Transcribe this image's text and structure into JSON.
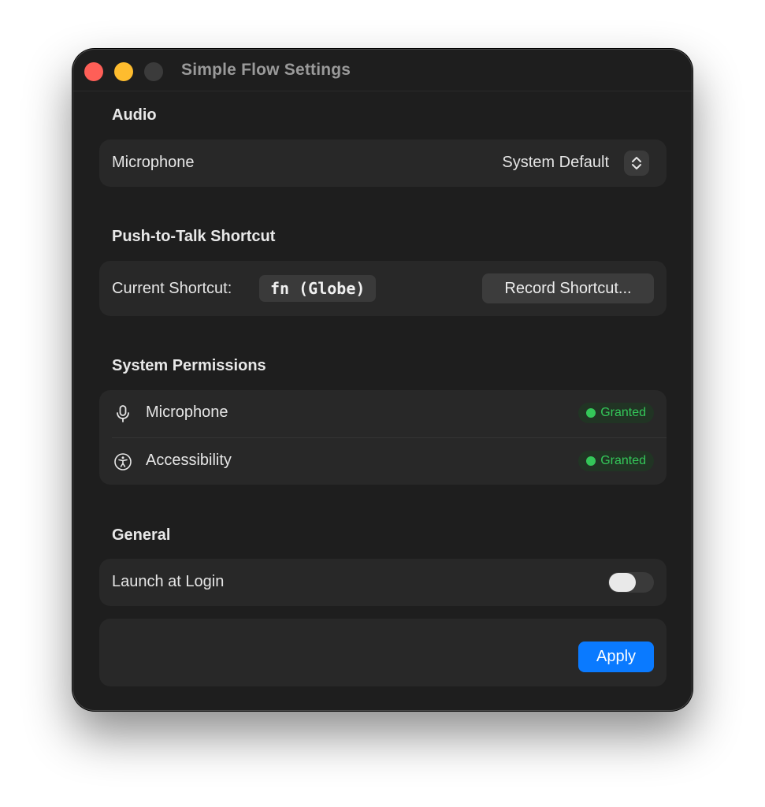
{
  "window": {
    "title": "Simple Flow Settings"
  },
  "audio": {
    "section_title": "Audio",
    "microphone_label": "Microphone",
    "microphone_value": "System Default"
  },
  "shortcut": {
    "section_title": "Push-to-Talk Shortcut",
    "current_label": "Current Shortcut:",
    "current_value": "fn (Globe)",
    "record_button": "Record Shortcut..."
  },
  "permissions": {
    "section_title": "System Permissions",
    "items": [
      {
        "label": "Microphone",
        "icon": "microphone-icon",
        "status": "Granted"
      },
      {
        "label": "Accessibility",
        "icon": "accessibility-icon",
        "status": "Granted"
      }
    ]
  },
  "general": {
    "section_title": "General",
    "launch_label": "Launch at Login",
    "launch_enabled": false
  },
  "footer": {
    "apply_button": "Apply"
  },
  "colors": {
    "accent": "#0a7aff",
    "granted": "#34c759",
    "close": "#fe5f57",
    "minimize": "#febc2e"
  }
}
